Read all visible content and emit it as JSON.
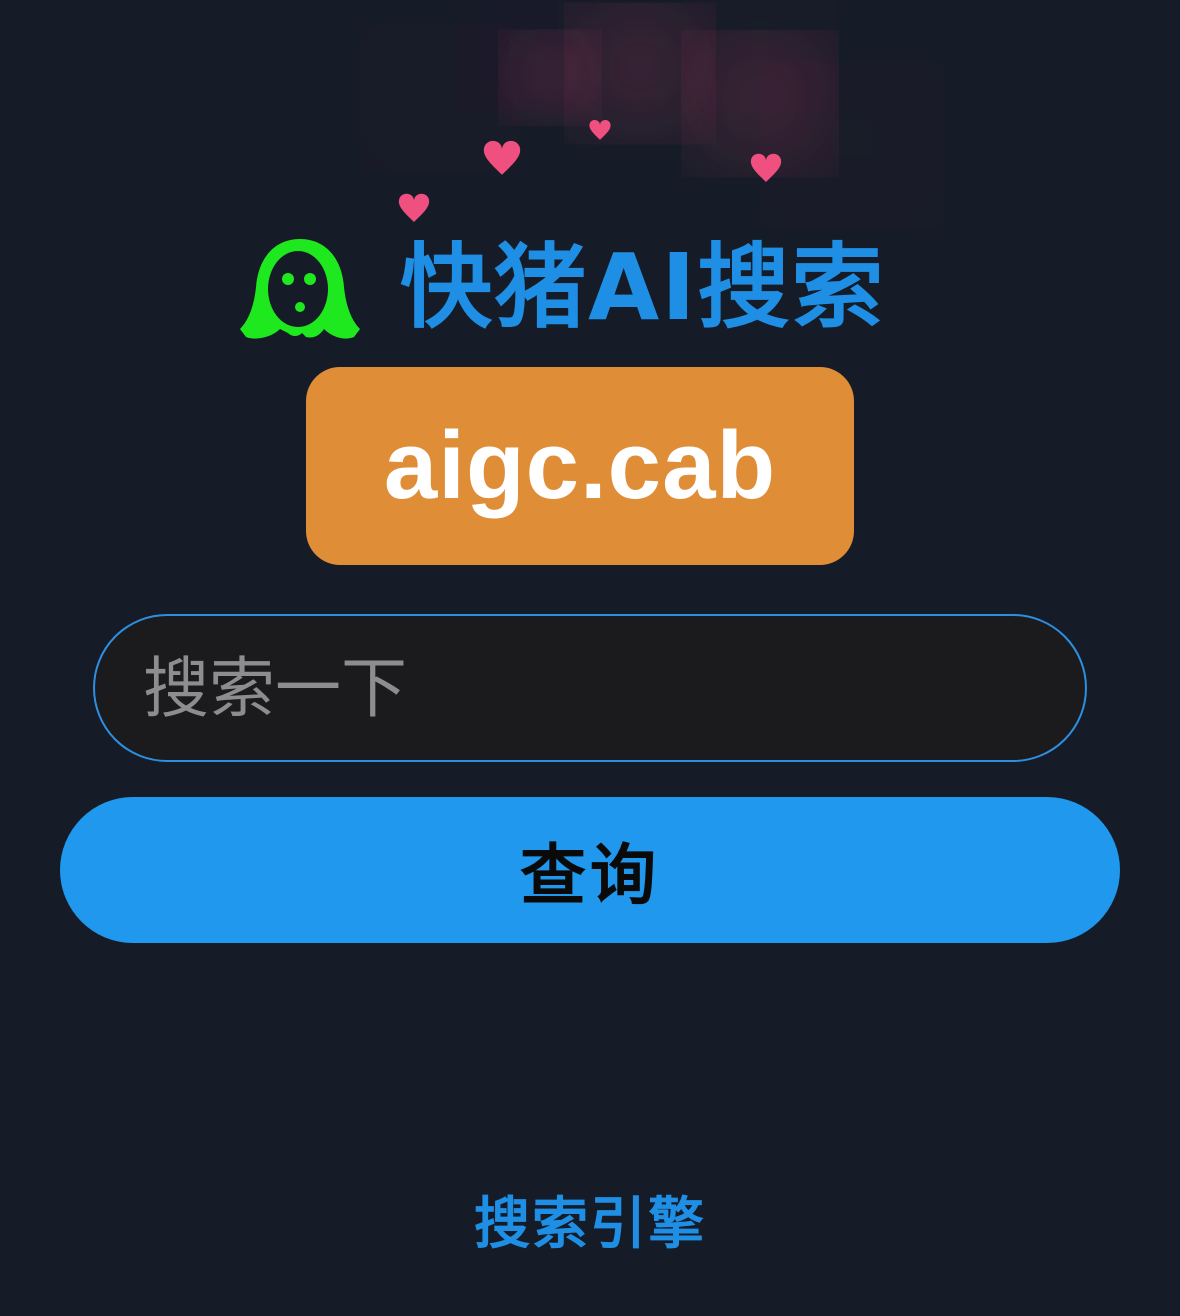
{
  "colors": {
    "background": "#151c27",
    "title": "#1e8fe4",
    "badge": "#e08d37",
    "button": "#1f98ee",
    "logo": "#1ee81e",
    "heart": "#f0507f"
  },
  "header": {
    "logo_icon": "ghost-icon",
    "title": "快猪AI搜索",
    "domain": "aigc.cab"
  },
  "search": {
    "placeholder": "搜索一下",
    "value": ""
  },
  "actions": {
    "query_label": "查询"
  },
  "footer": {
    "link_label": "搜索引擎"
  },
  "decoration": {
    "icon": "heart-icon"
  }
}
